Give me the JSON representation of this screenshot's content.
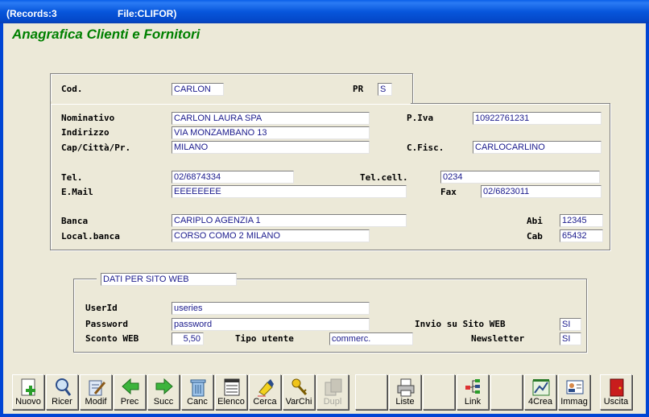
{
  "window": {
    "records": "(Records:3",
    "file": "File:CLIFOR)"
  },
  "form_title": "Anagrafica Clienti e Fornitori",
  "header": {
    "cod_label": "Cod.",
    "cod_value": "CARLON",
    "pr_label": "PR",
    "pr_value": "S"
  },
  "details": {
    "nominativo_label": "Nominativo",
    "nominativo": "CARLON LAURA SPA",
    "piva_label": "P.Iva",
    "piva": "10922761231",
    "indirizzo_label": "Indirizzo",
    "indirizzo": "VIA MONZAMBANO 13",
    "cap_label": "Cap/Città/Pr.",
    "citta": "MILANO",
    "cfisc_label": "C.Fisc.",
    "cfisc": "CARLOCARLINO",
    "tel_label": "Tel.",
    "tel": "02/6874334",
    "telcell_label": "Tel.cell.",
    "telcell": "0234",
    "email_label": "E.Mail",
    "email": "EEEEEEEE",
    "fax_label": "Fax",
    "fax": "02/6823011",
    "banca_label": "Banca",
    "banca": "CARIPLO  AGENZIA 1",
    "abi_label": "Abi",
    "abi": "12345",
    "localbanca_label": "Local.banca",
    "localbanca": "CORSO COMO 2  MILANO",
    "cab_label": "Cab",
    "cab": "65432"
  },
  "web": {
    "caption": "DATI PER SITO WEB",
    "userid_label": "UserId",
    "userid": "useries",
    "password_label": "Password",
    "password": "password",
    "invio_label": "Invio su Sito WEB",
    "invio": "SI",
    "sconto_label": "Sconto WEB",
    "sconto": "5,50",
    "tipo_label": "Tipo utente",
    "tipo": "commerc.",
    "newsletter_label": "Newsletter",
    "newsletter": "SI"
  },
  "toolbar": {
    "nuovo": "Nuovo",
    "ricer": "Ricer",
    "modif": "Modif",
    "prec": "Prec",
    "succ": "Succ",
    "canc": "Canc",
    "elenco": "Elenco",
    "cerca": "Cerca",
    "varchi": "VarChi",
    "dupl": "Dupl",
    "liste": "Liste",
    "link": "Link",
    "crea4": "4Crea",
    "immag": "Immag",
    "uscita": "Uscita"
  },
  "colors": {
    "title_green": "#008000",
    "field_text": "#1a1a8c",
    "titlebar_blue": "#0756dc"
  }
}
